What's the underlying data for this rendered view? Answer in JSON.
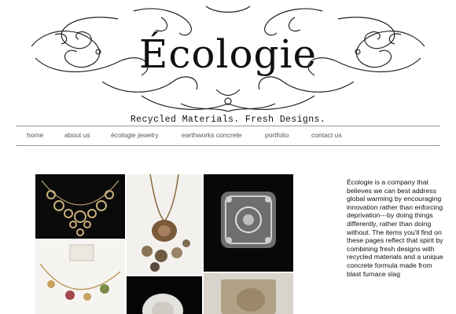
{
  "header": {
    "logo_text": "Écologie",
    "tagline": "Recycled Materials. Fresh Designs."
  },
  "nav": {
    "items": [
      {
        "label": "home"
      },
      {
        "label": "about us"
      },
      {
        "label": "écologie jewelry"
      },
      {
        "label": "earthworks concrete"
      },
      {
        "label": "portfolio"
      },
      {
        "label": "contact us"
      }
    ]
  },
  "intro": {
    "text": "Écologie is a company that believes we can best address global warming by encouraging innovation rather than enforcing deprivation---by doing things differently, rather than doing without. The items you'll find on these pages reflect that spirit by combining fresh designs with recycled materials and a unique concrete formula made from blast furnace slag"
  },
  "colors": {
    "background": "#ffffff",
    "text": "#111111",
    "nav_text": "#555555",
    "rule": "#9a9a9a"
  }
}
